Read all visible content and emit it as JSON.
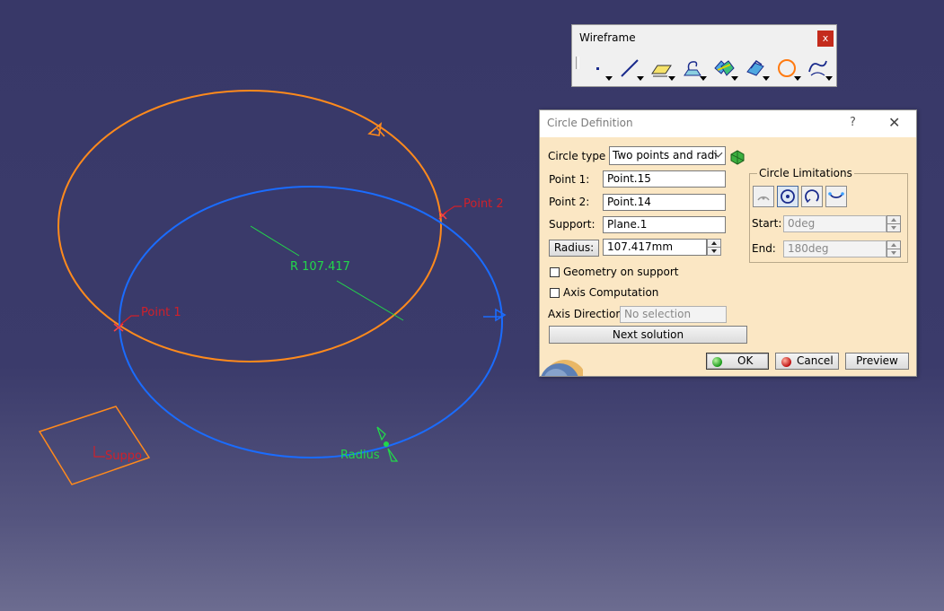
{
  "viewport": {
    "annotations": {
      "point1": "Point 1",
      "point2": "Point 2",
      "radius_dim": "R 107.417",
      "radius_handle": "Radius",
      "support": "Suppo"
    },
    "colors": {
      "background": "#3a3a6a",
      "orange_circle": "#ff8a1c",
      "blue_circle": "#1a6cff",
      "green_dim": "#22d84a",
      "red_label": "#d0202a"
    }
  },
  "toolbar": {
    "title": "Wireframe",
    "close": "x",
    "icons": [
      "point-icon",
      "line-icon",
      "plane-icon",
      "projection-icon",
      "intersection-icon",
      "offset-icon",
      "circle-icon",
      "spline-icon"
    ]
  },
  "dialog": {
    "title": "Circle Definition",
    "help": "?",
    "close": "✕",
    "circle_type_label": "Circle type :",
    "circle_type_value": "Two points and radi",
    "point1_label": "Point 1:",
    "point1_value": "Point.15",
    "point2_label": "Point 2:",
    "point2_value": "Point.14",
    "support_label": "Support:",
    "support_value": "Plane.1",
    "radius_button": "Radius:",
    "radius_value": "107.417mm",
    "geometry_on_support": "Geometry on support",
    "axis_computation": "Axis Computation",
    "axis_direction_label": "Axis Direction:",
    "axis_direction_placeholder": "No selection",
    "next_solution": "Next solution",
    "limitations": {
      "legend": "Circle Limitations",
      "start_label": "Start:",
      "start_value": "0deg",
      "end_label": "End:",
      "end_value": "180deg"
    },
    "ok": "OK",
    "cancel": "Cancel",
    "preview": "Preview"
  }
}
